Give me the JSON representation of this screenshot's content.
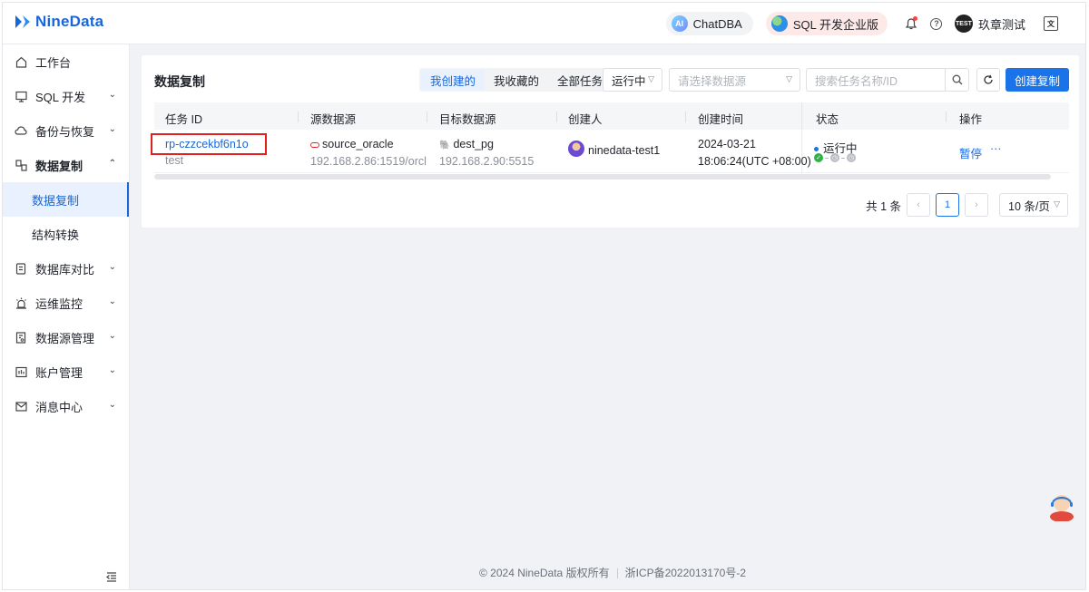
{
  "header": {
    "logo": "NineData",
    "chatdba": {
      "badge": "AI",
      "label": "ChatDBA"
    },
    "sql_edition": "SQL 开发企业版",
    "user": {
      "avatar": "TEST",
      "name": "玖章测试"
    }
  },
  "sidebar": {
    "items": [
      {
        "label": "工作台",
        "icon": "home-icon"
      },
      {
        "label": "SQL 开发",
        "icon": "monitor-icon"
      },
      {
        "label": "备份与恢复",
        "icon": "cloud-icon"
      },
      {
        "label": "数据复制",
        "icon": "replicate-icon"
      },
      {
        "label": "数据库对比",
        "icon": "compare-icon"
      },
      {
        "label": "运维监控",
        "icon": "alarm-icon"
      },
      {
        "label": "数据源管理",
        "icon": "datasource-icon"
      },
      {
        "label": "账户管理",
        "icon": "account-icon"
      },
      {
        "label": "消息中心",
        "icon": "mail-icon"
      }
    ],
    "sub_items": [
      "数据复制",
      "结构转换"
    ]
  },
  "main": {
    "title": "数据复制",
    "tabs": [
      "我创建的",
      "我收藏的",
      "全部任务"
    ],
    "status_filter": "运行中",
    "datasource_placeholder": "请选择数据源",
    "search_placeholder": "搜索任务名称/ID",
    "create_label": "创建复制",
    "table": {
      "columns": [
        "任务 ID",
        "源数据源",
        "目标数据源",
        "创建人",
        "创建时间",
        "状态",
        "操作"
      ],
      "rows": [
        {
          "task_id": "rp-czzcekbf6n1o",
          "task_name": "test",
          "source_name": "source_oracle",
          "source_addr": "192.168.2.86:1519/orcl",
          "target_name": "dest_pg",
          "target_addr": "192.168.2.90:5515",
          "creator": "ninedata-test1",
          "created_date": "2024-03-21",
          "created_time": "18:06:24(UTC +08:00)",
          "status": "运行中",
          "action_pause": "暂停",
          "action_more": "···"
        }
      ]
    },
    "pagination": {
      "total": "共 1 条",
      "current": "1",
      "page_size": "10 条/页"
    }
  },
  "footer": {
    "copyright": "© 2024 NineData 版权所有",
    "icp": "浙ICP备2022013170号-2"
  },
  "colors": {
    "accent": "#1a73e8",
    "highlight_box": "#e02020",
    "success": "#2fb344"
  }
}
